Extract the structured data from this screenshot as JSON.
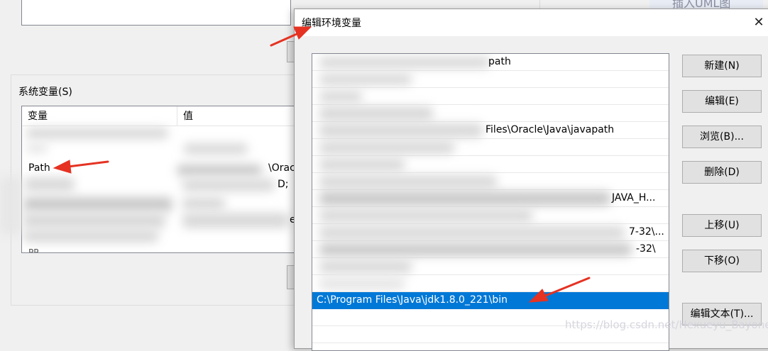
{
  "background_window": {
    "system_vars_label": "系统变量(S)",
    "columns": {
      "name": "变量",
      "value": "值"
    },
    "visible_rows": [
      {
        "name": "Path",
        "value": "\\Orac"
      }
    ],
    "partial_texts": {
      "r2": "D;",
      "r3": "e",
      "r4": "PP"
    },
    "top_right_text": "插入UML图"
  },
  "dialog": {
    "title": "编辑环境变量",
    "close_glyph": "✕",
    "entries": [
      "path",
      "Files\\Oracle\\Java\\javapath",
      "JAVA_H...",
      "7-32\\...",
      "-32\\",
      "C:\\Program Files\\Java\\jdk1.8.0_221\\bin"
    ],
    "selected_index": 5,
    "buttons": {
      "new": "新建(N)",
      "edit": "编辑(E)",
      "browse": "浏览(B)...",
      "delete": "删除(D)",
      "move_up": "上移(U)",
      "move_down": "下移(O)",
      "edit_text": "编辑文本(T)..."
    }
  },
  "watermark": "https://blog.csdn.net/Hexueyu_Bayonet",
  "colors": {
    "selection": "#0078d7",
    "arrow": "#e53222"
  }
}
